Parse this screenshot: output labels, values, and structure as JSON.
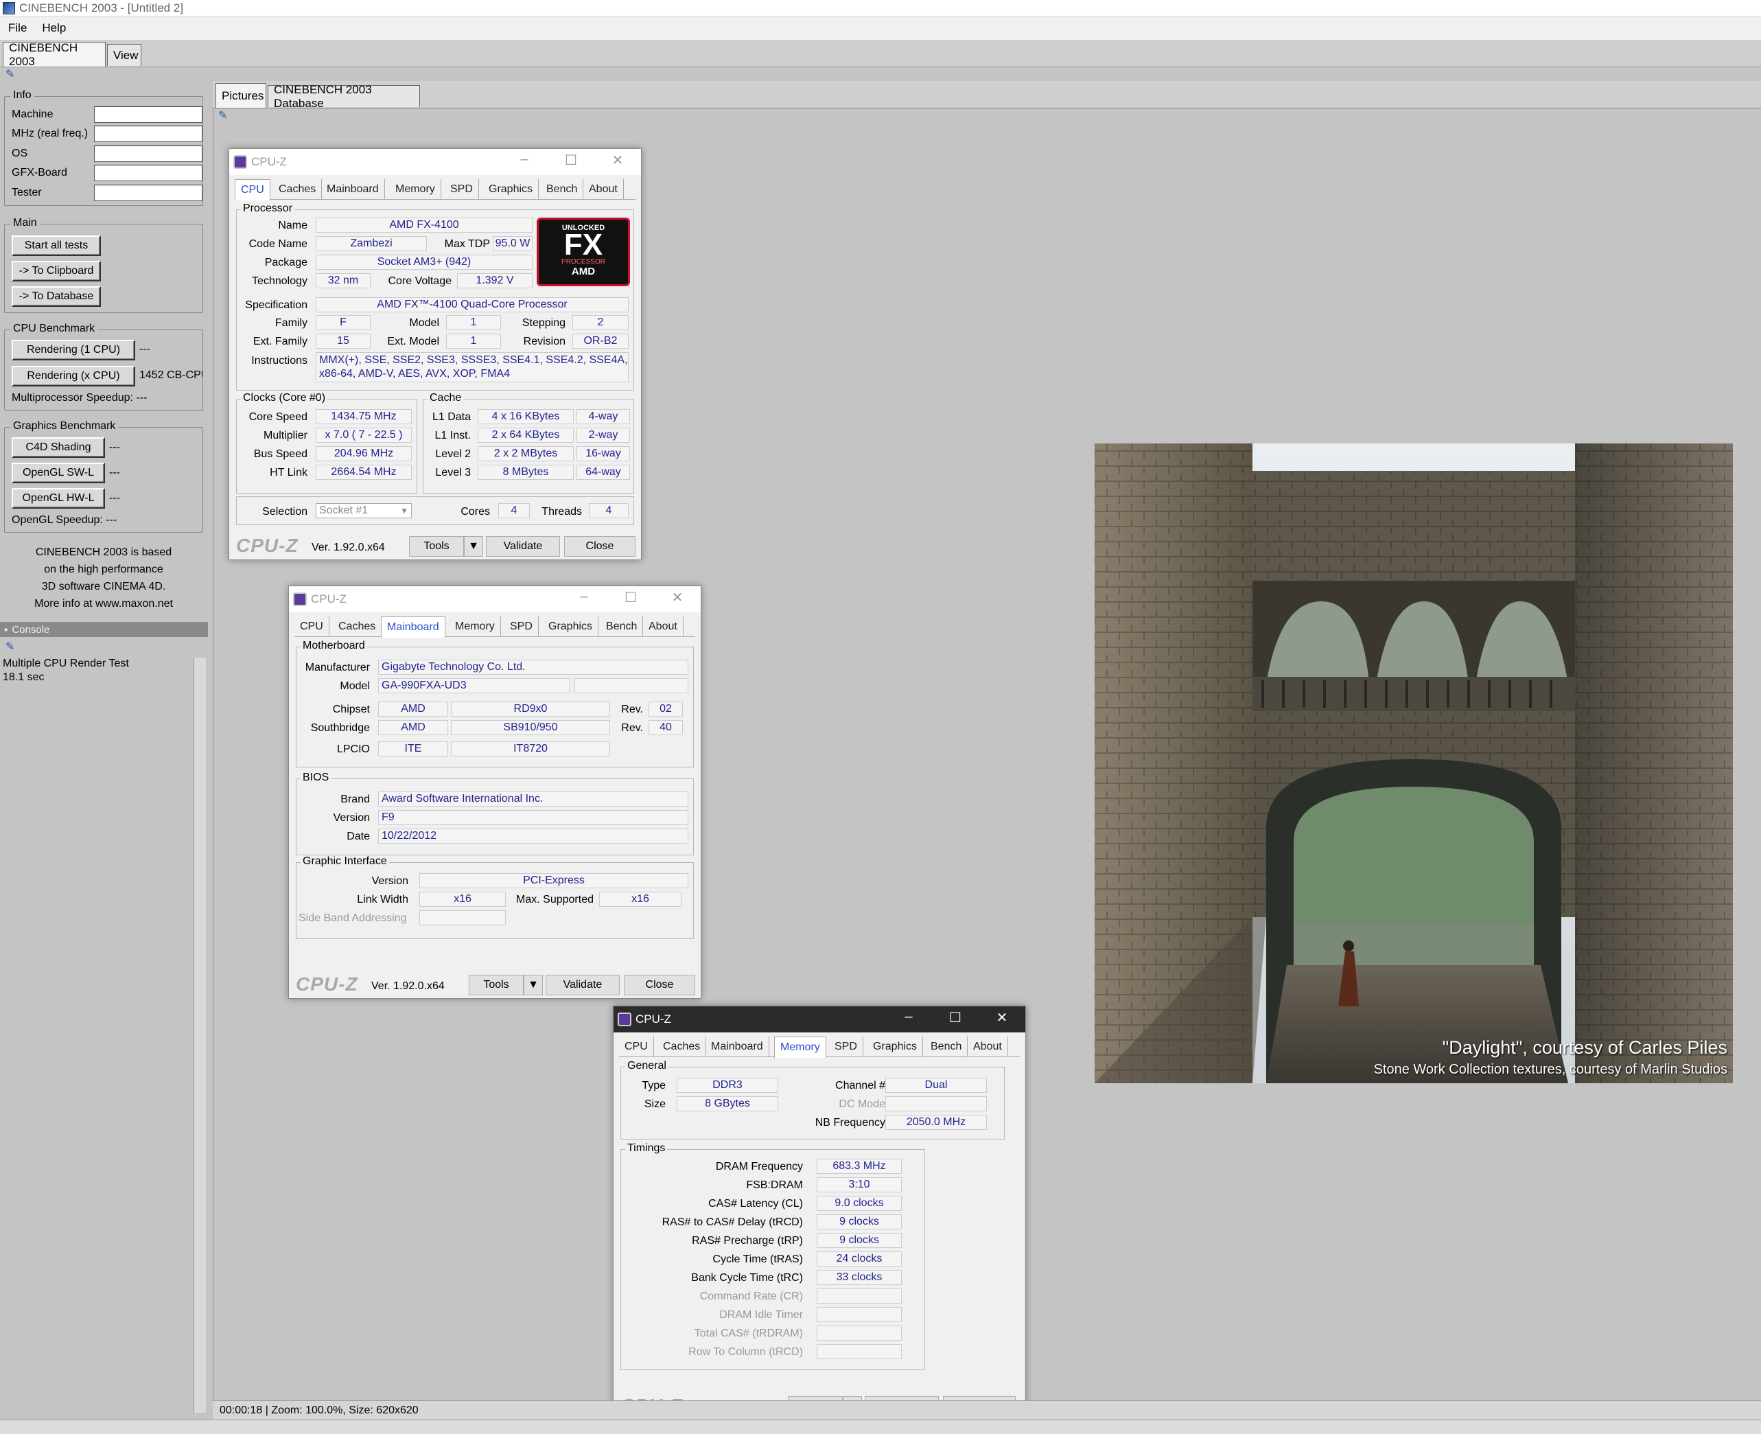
{
  "app": {
    "title": "CINEBENCH 2003 - [Untitled 2]",
    "menu": [
      "File",
      "Help"
    ],
    "top_tabs": [
      "CINEBENCH 2003",
      "View"
    ]
  },
  "info": {
    "title": "Info",
    "fields": [
      "Machine",
      "MHz (real freq.)",
      "OS",
      "GFX-Board",
      "Tester"
    ]
  },
  "main": {
    "title": "Main",
    "buttons": [
      "Start all tests",
      "-> To Clipboard",
      "-> To Database"
    ]
  },
  "cpu_benchmark": {
    "title": "CPU Benchmark",
    "btn_1cpu": "Rendering (1 CPU)",
    "res_1cpu": "---",
    "btn_xcpu": "Rendering (x CPU)",
    "res_xcpu": "1452 CB-CPU",
    "speedup": "Multiprocessor Speedup:  ---"
  },
  "graphics_benchmark": {
    "title": "Graphics Benchmark",
    "btn_c4d": "C4D Shading",
    "btn_swl": "OpenGL SW-L",
    "btn_hwl": "OpenGL HW-L",
    "dash": "---",
    "speedup": "OpenGL Speedup:  ---"
  },
  "about_text": [
    "CINEBENCH 2003 is based",
    "on the high performance",
    "3D software CINEMA 4D.",
    "More info at www.maxon.net"
  ],
  "console": {
    "title": "Console",
    "line1": "Multiple CPU Render Test",
    "line2": "18.1 sec"
  },
  "view_tabs": [
    "Pictures",
    "CINEBENCH 2003 Database"
  ],
  "status": "00:00:18 | Zoom: 100.0%, Size: 620x620",
  "render": {
    "caption1": "\"Daylight\", courtesy of Carles Piles",
    "caption2": "Stone Work Collection textures, courtesy of Marlin Studios"
  },
  "cpuz_common": {
    "title": "CPU-Z",
    "tabs": [
      "CPU",
      "Caches",
      "Mainboard",
      "Memory",
      "SPD",
      "Graphics",
      "Bench",
      "About"
    ],
    "logo": "CPU-Z",
    "version": "Ver. 1.92.0.x64",
    "tools": "Tools",
    "validate": "Validate",
    "close": "Close"
  },
  "cpu": {
    "processor": "Processor",
    "name_l": "Name",
    "name": "AMD FX-4100",
    "code_l": "Code Name",
    "code": "Zambezi",
    "tdp_l": "Max TDP",
    "tdp": "95.0 W",
    "package_l": "Package",
    "package": "Socket AM3+ (942)",
    "tech_l": "Technology",
    "tech": "32 nm",
    "volt_l": "Core Voltage",
    "volt": "1.392 V",
    "spec_l": "Specification",
    "spec": "AMD FX™-4100 Quad-Core Processor",
    "family_l": "Family",
    "family": "F",
    "model_l": "Model",
    "model": "1",
    "stepping_l": "Stepping",
    "stepping": "2",
    "extfam_l": "Ext. Family",
    "extfam": "15",
    "extmod_l": "Ext. Model",
    "extmod": "1",
    "rev_l": "Revision",
    "rev": "OR-B2",
    "instr_l": "Instructions",
    "instr1": "MMX(+), SSE, SSE2, SSE3, SSSE3, SSE4.1, SSE4.2, SSE4A,",
    "instr2": "x86-64, AMD-V, AES, AVX, XOP, FMA4",
    "clocks_title": "Clocks (Core #0)",
    "core_speed_l": "Core Speed",
    "core_speed": "1434.75 MHz",
    "mult_l": "Multiplier",
    "mult": "x 7.0 ( 7 - 22.5 )",
    "bus_l": "Bus Speed",
    "bus": "204.96 MHz",
    "ht_l": "HT Link",
    "ht": "2664.54 MHz",
    "cache_title": "Cache",
    "l1d_l": "L1 Data",
    "l1d": "4 x 16 KBytes",
    "l1d_w": "4-way",
    "l1i_l": "L1 Inst.",
    "l1i": "2 x 64 KBytes",
    "l1i_w": "2-way",
    "l2_l": "Level 2",
    "l2": "2 x 2 MBytes",
    "l2_w": "16-way",
    "l3_l": "Level 3",
    "l3": "8 MBytes",
    "l3_w": "64-way",
    "sel_l": "Selection",
    "sel": "Socket #1",
    "cores_l": "Cores",
    "cores": "4",
    "threads_l": "Threads",
    "threads": "4",
    "badge_top": "UNLOCKED",
    "badge_fx": "FX",
    "badge_proc": "PROCESSOR",
    "badge_amd": "AMD"
  },
  "mainboard": {
    "mb_title": "Motherboard",
    "manu_l": "Manufacturer",
    "manu": "Gigabyte Technology Co. Ltd.",
    "model_l": "Model",
    "model": "GA-990FXA-UD3",
    "chipset_l": "Chipset",
    "chipset_v": "AMD",
    "chipset_m": "RD9x0",
    "chipset_rev_l": "Rev.",
    "chipset_rev": "02",
    "south_l": "Southbridge",
    "south_v": "AMD",
    "south_m": "SB910/950",
    "south_rev_l": "Rev.",
    "south_rev": "40",
    "lpcio_l": "LPCIO",
    "lpcio_v": "ITE",
    "lpcio_m": "IT8720",
    "bios_title": "BIOS",
    "brand_l": "Brand",
    "brand": "Award Software International Inc.",
    "ver_l": "Version",
    "ver": "F9",
    "date_l": "Date",
    "date": "10/22/2012",
    "gi_title": "Graphic Interface",
    "giver_l": "Version",
    "giver": "PCI-Express",
    "lw_l": "Link Width",
    "lw": "x16",
    "ms_l": "Max. Supported",
    "ms": "x16",
    "sba_l": "Side Band Addressing"
  },
  "memory": {
    "gen_title": "General",
    "type_l": "Type",
    "type": "DDR3",
    "size_l": "Size",
    "size": "8 GBytes",
    "chan_l": "Channel #",
    "chan": "Dual",
    "dc_l": "DC Mode",
    "nb_l": "NB Frequency",
    "nb": "2050.0 MHz",
    "tim_title": "Timings",
    "dram_l": "DRAM Frequency",
    "dram": "683.3 MHz",
    "fsb_l": "FSB:DRAM",
    "fsb": "3:10",
    "cas_l": "CAS# Latency (CL)",
    "cas": "9.0 clocks",
    "trcd_l": "RAS# to CAS# Delay (tRCD)",
    "trcd": "9 clocks",
    "trp_l": "RAS# Precharge (tRP)",
    "trp": "9 clocks",
    "tras_l": "Cycle Time (tRAS)",
    "tras": "24 clocks",
    "trc_l": "Bank Cycle Time (tRC)",
    "trc": "33 clocks",
    "cr_l": "Command Rate (CR)",
    "idle_l": "DRAM Idle Timer",
    "tcas_l": "Total CAS# (tRDRAM)",
    "rtc_l": "Row To Column (tRCD)"
  },
  "colors": {
    "value_text": "#23238e",
    "tab_active": "#2a4cc8",
    "amd_red": "#c8102e"
  }
}
